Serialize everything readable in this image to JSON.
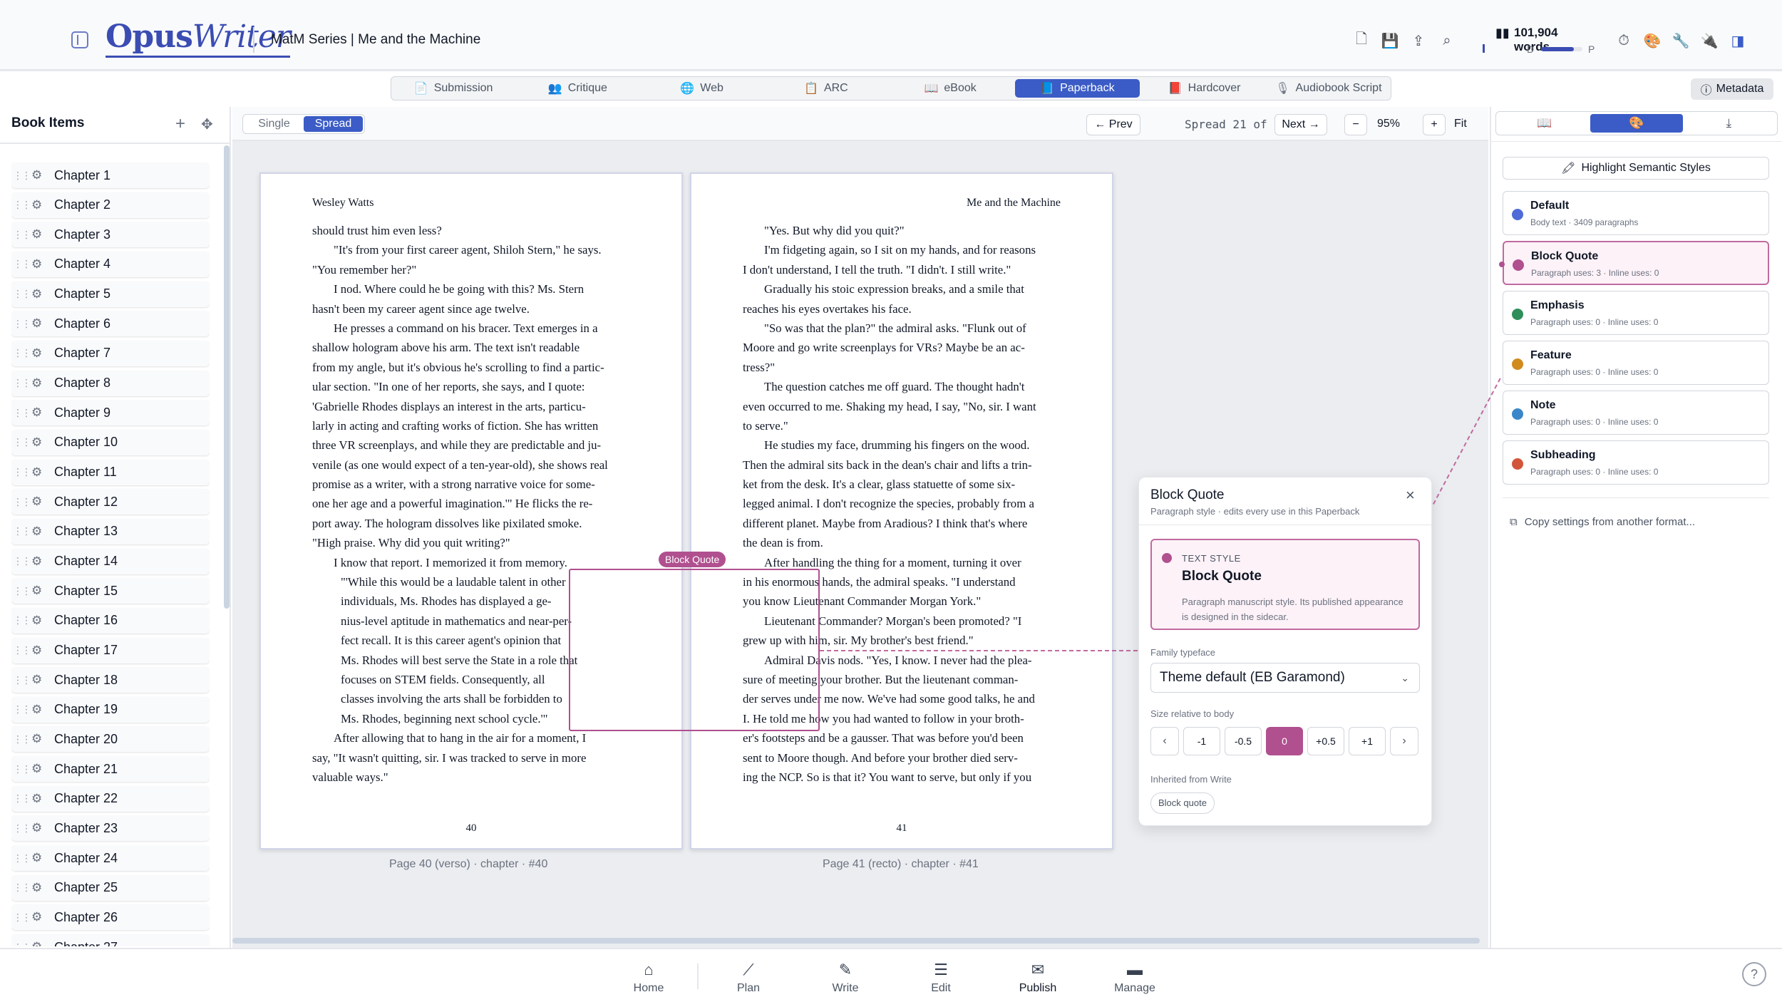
{
  "app": {
    "logo_a": "Opus",
    "logo_b": "Writer",
    "project_title": "MatM Series | Me and the Machine"
  },
  "header": {
    "icons": [
      "new-file-icon",
      "save-icon",
      "upload-icon",
      "search-icon",
      "timer-icon",
      "palette-icon",
      "wrench-icon",
      "plug-icon",
      "panel-toggle-icon"
    ],
    "word_count": "101,904 words",
    "progress_left": "D",
    "progress_right": "P",
    "progress_fraction": 0.8
  },
  "format_tabs": [
    {
      "label": "Submission",
      "icon": "📄"
    },
    {
      "label": "Critique",
      "icon": "👥"
    },
    {
      "label": "Web",
      "icon": "🌐"
    },
    {
      "label": "ARC",
      "icon": "📋"
    },
    {
      "label": "eBook",
      "icon": "📖"
    },
    {
      "label": "Paperback",
      "icon": "📘",
      "active": true
    },
    {
      "label": "Hardcover",
      "icon": "📕"
    },
    {
      "label": "Audiobook Script",
      "icon": "🎙"
    }
  ],
  "metadata_label": "Metadata",
  "sidebar": {
    "title": "Book Items",
    "chapters": [
      "Chapter 1",
      "Chapter 2",
      "Chapter 3",
      "Chapter 4",
      "Chapter 5",
      "Chapter 6",
      "Chapter 7",
      "Chapter 8",
      "Chapter 9",
      "Chapter 10",
      "Chapter 11",
      "Chapter 12",
      "Chapter 13",
      "Chapter 14",
      "Chapter 15",
      "Chapter 16",
      "Chapter 17",
      "Chapter 18",
      "Chapter 19",
      "Chapter 20",
      "Chapter 21",
      "Chapter 22",
      "Chapter 23",
      "Chapter 24",
      "Chapter 25",
      "Chapter 26",
      "Chapter 27"
    ]
  },
  "toolbar": {
    "view_single": "Single",
    "view_spread": "Spread",
    "prev": "← Prev",
    "spread_info": "Spread 21 of 230",
    "next": "Next →",
    "zoom_out": "−",
    "zoom": "95%",
    "zoom_in": "+",
    "fit": "Fit"
  },
  "left_page": {
    "header": "Wesley Watts",
    "number": "40",
    "caption": "Page 40 (verso) · chapter · #40",
    "lines": [
      {
        "t": "should trust him even less?",
        "k": "plain"
      },
      {
        "t": "\"It's from your first career agent, Shiloh Stern,\" he says.",
        "k": "ind"
      },
      {
        "t": "\"You remember her?\"",
        "k": "plain"
      },
      {
        "t": "I nod. Where could he be going with this? Ms. Stern",
        "k": "ind"
      },
      {
        "t": "hasn't been my career agent since age twelve.",
        "k": "plain"
      },
      {
        "t": "He presses a command on his bracer. Text emerges in a",
        "k": "ind"
      },
      {
        "t": "shallow hologram above his arm. The text isn't readable",
        "k": "plain"
      },
      {
        "t": "from my angle, but it's obvious he's scrolling to find a partic-",
        "k": "plain"
      },
      {
        "t": "ular section. \"In one of her reports, she says, and I quote:",
        "k": "plain"
      },
      {
        "t": "'Gabrielle Rhodes displays an interest in the arts, particu-",
        "k": "plain"
      },
      {
        "t": "larly in acting and crafting works of fiction. She has written",
        "k": "plain"
      },
      {
        "t": "three VR screenplays, and while they are predictable and ju-",
        "k": "plain"
      },
      {
        "t": "venile (as one would expect of a ten-year-old), she shows real",
        "k": "plain"
      },
      {
        "t": "promise as a writer, with a strong narrative voice for some-",
        "k": "plain"
      },
      {
        "t": "one her age and a powerful imagination.'\" He flicks the re-",
        "k": "plain"
      },
      {
        "t": "port away. The hologram dissolves like pixilated smoke.",
        "k": "plain"
      },
      {
        "t": "\"High praise. Why did you quit writing?\"",
        "k": "plain"
      },
      {
        "t": "I know that report. I memorized it from memory.",
        "k": "ind"
      },
      {
        "t": "\"'While this would be a laudable talent in other",
        "k": "bq"
      },
      {
        "t": "individuals, Ms. Rhodes has displayed a ge-",
        "k": "bq"
      },
      {
        "t": "nius-level aptitude in mathematics and near-per-",
        "k": "bq"
      },
      {
        "t": "fect recall. It is this career agent's opinion that",
        "k": "bq"
      },
      {
        "t": "Ms. Rhodes will best serve the State in a role that",
        "k": "bq"
      },
      {
        "t": "focuses on STEM fields. Consequently, all",
        "k": "bq"
      },
      {
        "t": "classes involving the arts shall be forbidden to",
        "k": "bq"
      },
      {
        "t": "Ms. Rhodes, beginning next school cycle.'\"",
        "k": "bq"
      },
      {
        "t": "After allowing that to hang in the air for a moment, I",
        "k": "ind"
      },
      {
        "t": "say, \"It wasn't quitting, sir. I was tracked to serve in more",
        "k": "plain"
      },
      {
        "t": "valuable ways.\"",
        "k": "plain"
      }
    ]
  },
  "right_page": {
    "header": "Me and the Machine",
    "number": "41",
    "caption": "Page 41 (recto) · chapter · #41",
    "lines": [
      {
        "t": "\"Yes. But why did you quit?\"",
        "k": "ind"
      },
      {
        "t": "I'm fidgeting again, so I sit on my hands, and for reasons",
        "k": "ind"
      },
      {
        "t": "I don't understand, I tell the truth. \"I didn't. I still write.\"",
        "k": "plain"
      },
      {
        "t": "Gradually his stoic expression breaks, and a smile that",
        "k": "ind"
      },
      {
        "t": "reaches his eyes overtakes his face.",
        "k": "plain"
      },
      {
        "t": "\"So was that the plan?\" the admiral asks. \"Flunk out of",
        "k": "ind"
      },
      {
        "t": "Moore and go write screenplays for VRs? Maybe be an ac-",
        "k": "plain"
      },
      {
        "t": "tress?\"",
        "k": "plain"
      },
      {
        "t": "The question catches me off guard. The thought hadn't",
        "k": "ind"
      },
      {
        "t": "even occurred to me. Shaking my head, I say, \"No, sir. I want",
        "k": "plain"
      },
      {
        "t": "to serve.\"",
        "k": "plain"
      },
      {
        "t": "He studies my face, drumming his fingers on the wood.",
        "k": "ind"
      },
      {
        "t": "Then the admiral sits back in the dean's chair and lifts a trin-",
        "k": "plain"
      },
      {
        "t": "ket from the desk. It's a clear, glass statuette of some six-",
        "k": "plain"
      },
      {
        "t": "legged animal. I don't recognize the species, probably from a",
        "k": "plain"
      },
      {
        "t": "different planet. Maybe from Aradious? I think that's where",
        "k": "plain"
      },
      {
        "t": "the dean is from.",
        "k": "plain"
      },
      {
        "t": "After handling the thing for a moment, turning it over",
        "k": "ind"
      },
      {
        "t": "in his enormous hands, the admiral speaks. \"I understand",
        "k": "plain"
      },
      {
        "t": "you know Lieutenant Commander Morgan York.\"",
        "k": "plain"
      },
      {
        "t": "Lieutenant Commander? Morgan's been promoted? \"I",
        "k": "ind"
      },
      {
        "t": "grew up with him, sir. My brother's best friend.\"",
        "k": "plain"
      },
      {
        "t": "Admiral Davis nods. \"Yes, I know. I never had the plea-",
        "k": "ind"
      },
      {
        "t": "sure of meeting your brother. But the lieutenant comman-",
        "k": "plain"
      },
      {
        "t": "der serves under me now. We've had some good talks, he and",
        "k": "plain"
      },
      {
        "t": "I. He told me how you had wanted to follow in your broth-",
        "k": "plain"
      },
      {
        "t": "er's footsteps and be a gausser. That was before you'd been",
        "k": "plain"
      },
      {
        "t": "sent to Moore though. And before your brother died serv-",
        "k": "plain"
      },
      {
        "t": "ing the NCP. So is that it? You want to serve, but only if you",
        "k": "plain"
      }
    ]
  },
  "block_quote_tag": "Block Quote",
  "popup": {
    "title": "Block Quote",
    "subtitle": "Paragraph style · edits every use in this Paperback",
    "card_kicker": "TEXT STYLE",
    "card_title": "Block Quote",
    "card_desc": "Paragraph manuscript style. Its published appearance is designed in the sidecar.",
    "family_label": "Family typeface",
    "family_value": "Theme default (EB Garamond)",
    "size_label": "Size relative to body",
    "sizes": [
      "-1",
      "-0.5",
      "0",
      "+0.5",
      "+1"
    ],
    "active_size": "0",
    "inherited_label": "Inherited from Write",
    "inherited_chip": "Block quote"
  },
  "right_panel": {
    "tabs": [
      "book-icon",
      "palette-icon",
      "download-icon"
    ],
    "highlight_label": "Highlight Semantic Styles",
    "styles": [
      {
        "name": "Default",
        "meta": "Body text · 3409 paragraphs",
        "color": "#4f6bd8"
      },
      {
        "name": "Block Quote",
        "meta": "Paragraph uses: 3 · Inline uses: 0",
        "color": "#b0508f",
        "active": true
      },
      {
        "name": "Emphasis",
        "meta": "Paragraph uses: 0 · Inline uses: 0",
        "color": "#2f8f5b"
      },
      {
        "name": "Feature",
        "meta": "Paragraph uses: 0 · Inline uses: 0",
        "color": "#d08a1e"
      },
      {
        "name": "Note",
        "meta": "Paragraph uses: 0 · Inline uses: 0",
        "color": "#3a86c8"
      },
      {
        "name": "Subheading",
        "meta": "Paragraph uses: 0 · Inline uses: 0",
        "color": "#d2553a"
      }
    ],
    "copy_settings": "Copy settings from another format..."
  },
  "bottom_nav": [
    {
      "label": "Home",
      "icon": "⌂"
    },
    {
      "label": "Plan",
      "icon": "⟋"
    },
    {
      "label": "Write",
      "icon": "✎"
    },
    {
      "label": "Edit",
      "icon": "☰"
    },
    {
      "label": "Publish",
      "icon": "✉",
      "active": true
    },
    {
      "label": "Manage",
      "icon": "▬"
    }
  ]
}
